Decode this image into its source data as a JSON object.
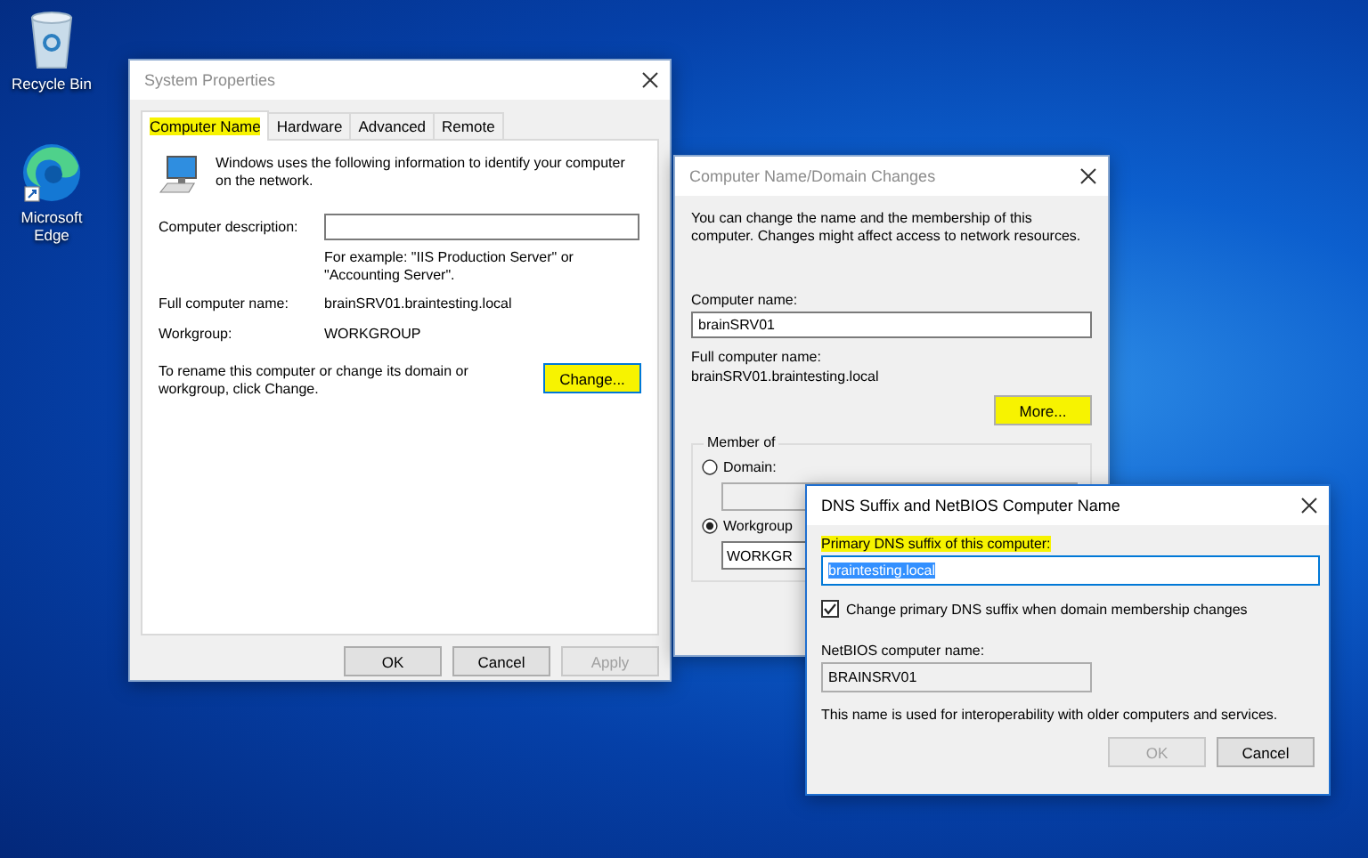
{
  "desktop_icons": [
    {
      "kind": "recycle",
      "label": "Recycle Bin"
    },
    {
      "kind": "edge",
      "label": "Microsoft Edge"
    }
  ],
  "system_properties": {
    "title": "System Properties",
    "active": false,
    "tabs": [
      {
        "label": "Computer Name",
        "selected": true,
        "highlighted": true
      },
      {
        "label": "Hardware",
        "selected": false,
        "highlighted": false
      },
      {
        "label": "Advanced",
        "selected": false,
        "highlighted": false
      },
      {
        "label": "Remote",
        "selected": false,
        "highlighted": false
      }
    ],
    "intro": "Windows uses the following information to identify your computer on the network.",
    "description_label": "Computer description:",
    "example": "For example: \"IIS Production Server\" or \"Accounting Server\".",
    "full_name_label": "Full computer name:",
    "full_name": "brainSRV01.braintesting.local",
    "workgroup_label": "Workgroup:",
    "workgroup": "WORKGROUP",
    "rename_text": "To rename this computer or change its domain or workgroup, click Change.",
    "change_button": {
      "label": "Change...",
      "highlighted": true
    },
    "buttons": [
      {
        "label": "OK",
        "disabled": false
      },
      {
        "label": "Cancel",
        "disabled": false
      },
      {
        "label": "Apply",
        "disabled": true
      }
    ]
  },
  "domain_changes": {
    "title": "Computer Name/Domain Changes",
    "active": false,
    "intro": "You can change the name and the membership of this computer. Changes might affect access to network resources.",
    "name_label": "Computer name:",
    "name_value": "brainSRV01",
    "full_name_label": "Full computer name:",
    "full_name": "brainSRV01.braintesting.local",
    "more_button": {
      "label": "More...",
      "highlighted": true
    },
    "member_of": {
      "legend": "Member of",
      "options": [
        {
          "label": "Domain:",
          "selected": false
        },
        {
          "label": "Workgroup",
          "selected": true,
          "value": "WORKGR"
        }
      ]
    }
  },
  "dns_dialog": {
    "title": "DNS Suffix and NetBIOS Computer Name",
    "active": true,
    "suffix_label": {
      "text": "Primary DNS suffix of this computer:",
      "highlighted": true
    },
    "suffix_value": "braintesting.local",
    "suffix_selected": true,
    "checkbox": {
      "label": "Change primary DNS suffix when domain membership changes",
      "checked": true
    },
    "netbios_label": "NetBIOS computer name:",
    "netbios_value": "BRAINSRV01",
    "note": "This name is used for interoperability with older computers and services.",
    "buttons": [
      {
        "label": "OK",
        "disabled": true
      },
      {
        "label": "Cancel",
        "disabled": false
      }
    ]
  }
}
